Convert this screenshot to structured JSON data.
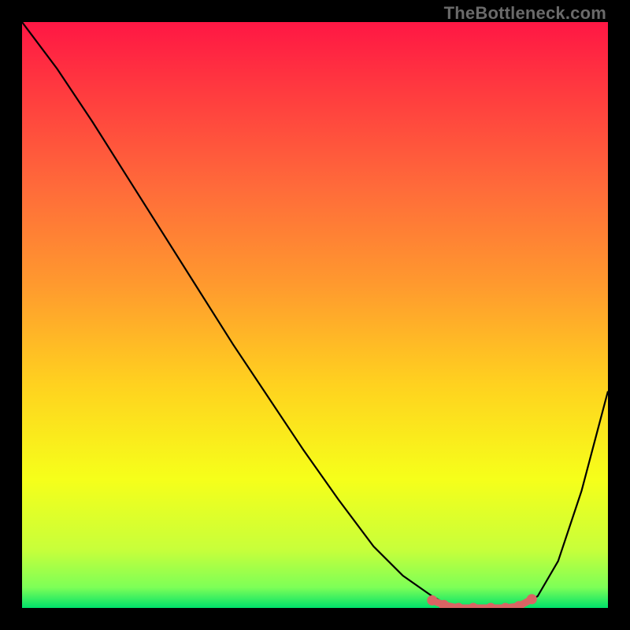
{
  "watermark": "TheBottleneck.com",
  "colors": {
    "frame": "#000000",
    "curve": "#000000",
    "marker": "#d96464",
    "watermark": "#6a6a6a",
    "gradient_stops": [
      {
        "offset": 0.0,
        "color": "#ff1744"
      },
      {
        "offset": 0.12,
        "color": "#ff3b3f"
      },
      {
        "offset": 0.28,
        "color": "#ff6a3a"
      },
      {
        "offset": 0.45,
        "color": "#ff9a2e"
      },
      {
        "offset": 0.62,
        "color": "#ffd21f"
      },
      {
        "offset": 0.78,
        "color": "#f6ff1a"
      },
      {
        "offset": 0.9,
        "color": "#c8ff3a"
      },
      {
        "offset": 0.965,
        "color": "#7dff57"
      },
      {
        "offset": 1.0,
        "color": "#00e06a"
      }
    ]
  },
  "chart_data": {
    "type": "line",
    "title": "",
    "xlabel": "",
    "ylabel": "",
    "xlim": [
      0,
      1
    ],
    "ylim": [
      0,
      1
    ],
    "note": "Axes are fractional; no tick labels are shown in the image. y is fractional height from bottom (0) to top (1) within the plot area.",
    "series": [
      {
        "name": "bottleneck-curve",
        "x": [
          0.0,
          0.06,
          0.12,
          0.18,
          0.24,
          0.3,
          0.36,
          0.42,
          0.48,
          0.54,
          0.6,
          0.65,
          0.7,
          0.735,
          0.77,
          0.81,
          0.845,
          0.88,
          0.915,
          0.955,
          1.0
        ],
        "y": [
          1.0,
          0.92,
          0.83,
          0.735,
          0.64,
          0.545,
          0.45,
          0.36,
          0.27,
          0.185,
          0.105,
          0.055,
          0.02,
          0.0,
          0.0,
          0.0,
          0.0,
          0.02,
          0.08,
          0.2,
          0.37
        ]
      }
    ],
    "valley_markers": {
      "name": "valley-markers",
      "x": [
        0.7,
        0.72,
        0.745,
        0.77,
        0.8,
        0.825,
        0.848,
        0.87
      ],
      "y": [
        0.013,
        0.005,
        0.0,
        0.0,
        0.0,
        0.0,
        0.003,
        0.015
      ]
    }
  }
}
